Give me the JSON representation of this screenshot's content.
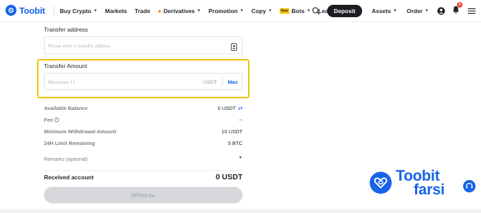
{
  "brand": {
    "name": "Toobit"
  },
  "nav": {
    "items": [
      {
        "label": "Buy Crypto",
        "has_caret": true
      },
      {
        "label": "Markets",
        "has_caret": false
      },
      {
        "label": "Trade",
        "has_caret": false
      },
      {
        "label": "Derivatives",
        "has_caret": true
      },
      {
        "label": "Promotion",
        "has_caret": true
      },
      {
        "label": "Copy",
        "has_caret": true
      },
      {
        "label": "Bots",
        "has_caret": true
      },
      {
        "label": "Learn",
        "has_caret": false
      }
    ],
    "bots_badge": "New",
    "deposit": "Deposit",
    "assets": "Assets",
    "order": "Order",
    "notification_count": "5"
  },
  "form": {
    "address_label": "Transfer address",
    "address_placeholder": "Please enter a transfer address",
    "amount_label": "Transfer Amount",
    "amount_placeholder": "Minimum 11",
    "amount_unit": "USDT",
    "max_label": "Max",
    "info_rows": [
      {
        "label": "Available Balance",
        "value": "0 USDT"
      },
      {
        "label": "Fee",
        "value": "--"
      },
      {
        "label": "Minimum Withdrawal Amount",
        "value": "10 USDT"
      },
      {
        "label": "24H Limit Remaining",
        "value": "5 BTC"
      }
    ],
    "remarks_label": "Remarks (optional)",
    "received_label": "Received account",
    "received_amount": "0 USDT",
    "withdraw_label": "Withdraw"
  },
  "watermark": {
    "line1": "Toobit",
    "line2": "farsi"
  },
  "colors": {
    "accent": "#1764e8",
    "highlight": "#f2c200",
    "button_dark": "#1b1d22"
  }
}
